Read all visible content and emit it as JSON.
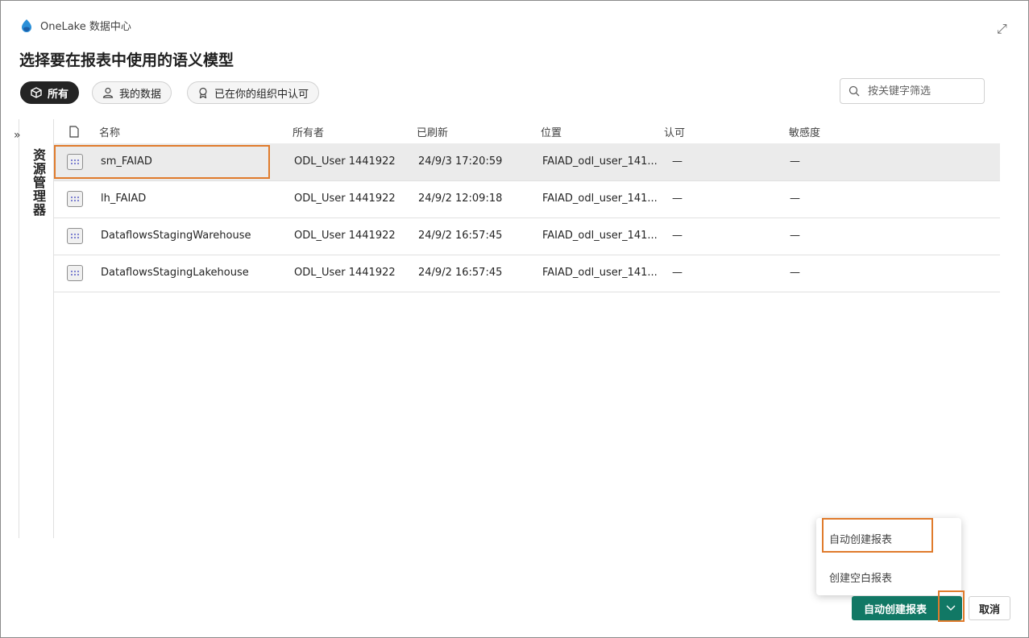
{
  "header": {
    "hub_name": "OneLake 数据中心",
    "title": "选择要在报表中使用的语义模型"
  },
  "filters": {
    "all": "所有",
    "my_data": "我的数据",
    "endorsed": "已在你的组织中认可",
    "search_placeholder": "按关键字筛选"
  },
  "explorer": {
    "label": "资源管理器"
  },
  "table": {
    "columns": [
      "名称",
      "所有者",
      "已刷新",
      "位置",
      "认可",
      "敏感度"
    ],
    "rows": [
      {
        "name": "sm_FAIAD",
        "owner": "ODL_User 1441922",
        "refreshed": "24/9/3 17:20:59",
        "location": "FAIAD_odl_user_141...",
        "endorsement": "—",
        "sensitivity": "—"
      },
      {
        "name": "lh_FAIAD",
        "owner": "ODL_User 1441922",
        "refreshed": "24/9/2 12:09:18",
        "location": "FAIAD_odl_user_141...",
        "endorsement": "—",
        "sensitivity": "—"
      },
      {
        "name": "DataflowsStagingWarehouse",
        "owner": "ODL_User 1441922",
        "refreshed": "24/9/2 16:57:45",
        "location": "FAIAD_odl_user_141...",
        "endorsement": "—",
        "sensitivity": "—"
      },
      {
        "name": "DataflowsStagingLakehouse",
        "owner": "ODL_User 1441922",
        "refreshed": "24/9/2 16:57:45",
        "location": "FAIAD_odl_user_141...",
        "endorsement": "—",
        "sensitivity": "—"
      }
    ]
  },
  "menu": {
    "auto_create": "自动创建报表",
    "create_blank": "创建空白报表"
  },
  "footer": {
    "primary": "自动创建报表",
    "cancel": "取消"
  },
  "colors": {
    "primary": "#117865",
    "highlight": "#e07b2c",
    "selected_row": "#ebebeb"
  }
}
